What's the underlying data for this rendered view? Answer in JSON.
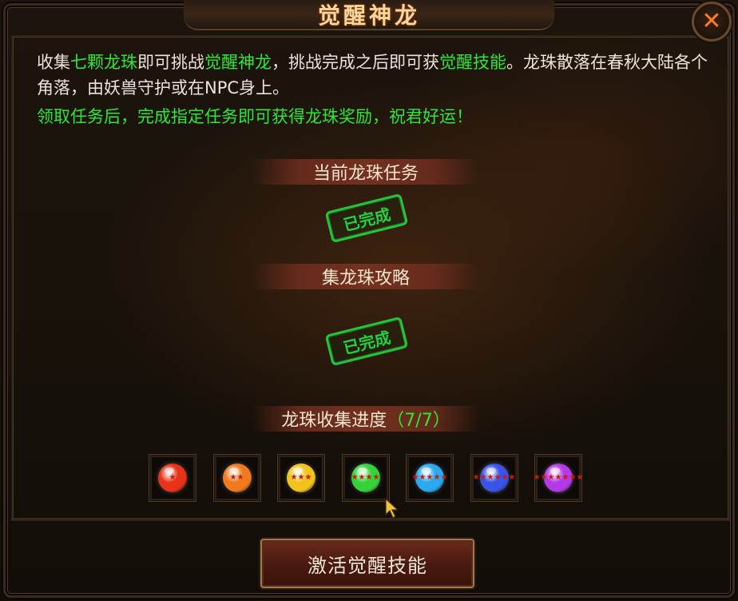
{
  "window": {
    "title": "觉醒神龙",
    "close_label": "✕"
  },
  "description": {
    "p1": "收集",
    "p2": "七颗龙珠",
    "p3": "即可挑战",
    "p4": "觉醒神龙",
    "p5": "，挑战完成之后即可获",
    "p6": "觉醒技能",
    "p7": "。龙珠散落在春秋大陆各个角落，由妖兽守护或在NPC身上。",
    "green_line": "领取任务后，完成指定任务即可获得龙珠奖励，祝君好运！"
  },
  "sections": {
    "current_task": {
      "title": "当前龙珠任务",
      "status": "已完成"
    },
    "guide": {
      "title": "集龙珠攻略",
      "status": "已完成"
    },
    "progress": {
      "title": "龙珠收集进度",
      "count": "（7/7）",
      "collected": 7,
      "total": 7
    }
  },
  "orbs": [
    {
      "name": "red",
      "color": "#e8321a",
      "stars": "★"
    },
    {
      "name": "orange",
      "color": "#f07a1e",
      "stars": "★★"
    },
    {
      "name": "yellow",
      "color": "#f2c21e",
      "stars": "★★★"
    },
    {
      "name": "green",
      "color": "#36d23a",
      "stars": "★★★★"
    },
    {
      "name": "cyan",
      "color": "#2aa8f0",
      "stars": "★★★★★"
    },
    {
      "name": "blue",
      "color": "#3a54e8",
      "stars": "★★★★★★"
    },
    {
      "name": "purple",
      "color": "#b43ae8",
      "stars": "★★★★★★★"
    }
  ],
  "actions": {
    "activate_label": "激活觉醒技能"
  },
  "colors": {
    "highlight_green": "#2ee832",
    "title_gold": "#f7d7a0",
    "close_orange": "#ff7a2a"
  }
}
